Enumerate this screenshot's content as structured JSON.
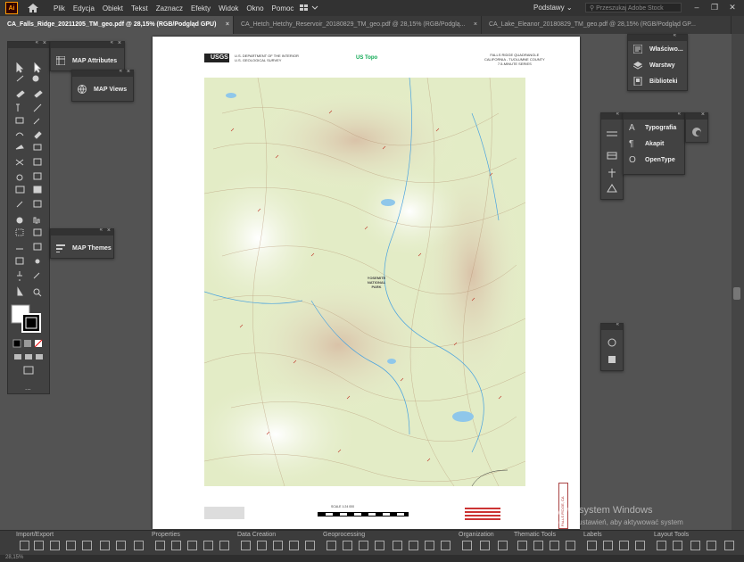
{
  "app": {
    "logo": "Ai",
    "colors": {
      "accent": "#ff9a00",
      "bg": "#535353",
      "panel": "#424242"
    }
  },
  "menu": {
    "items": [
      "Plik",
      "Edycja",
      "Obiekt",
      "Tekst",
      "Zaznacz",
      "Efekty",
      "Widok",
      "Okno",
      "Pomoc"
    ],
    "workspace": "Podstawy",
    "search_placeholder": "Przeszukaj Adobe Stock"
  },
  "tabs": [
    {
      "label": "CA_Falls_Ridge_20211205_TM_geo.pdf @ 28,15% (RGB/Podgląd GPU)",
      "close": "×",
      "active": true
    },
    {
      "label": "CA_Hetch_Hetchy_Reservoir_20180829_TM_geo.pdf @ 28,15% (RGB/Podglą...",
      "close": "×",
      "active": false
    },
    {
      "label": "CA_Lake_Eleanor_20180829_TM_geo.pdf @ 28,15% (RGB/Podgląd GP...",
      "close": "",
      "active": false
    }
  ],
  "panels": {
    "map_attributes": "MAP Attributes",
    "map_views": "MAP Views",
    "map_themes": "MAP Themes",
    "properties_group": [
      "Właściwo...",
      "Warstwy",
      "Biblioteki"
    ],
    "type_group": [
      "Typografia",
      "Akapit",
      "OpenType"
    ]
  },
  "map_sheet": {
    "agency_line1": "U.S. DEPARTMENT OF THE INTERIOR",
    "agency_line2": "U.S. GEOLOGICAL SURVEY",
    "logo": "USGS",
    "ustopo": "US Topo",
    "quad_name": "FALLS RIDGE QUADRANGLE",
    "quad_state": "CALIFORNIA - TUOLUMNE COUNTY",
    "quad_series": "7.5-MINUTE SERIES",
    "park_label": "YOSEMITE NATIONAL PARK",
    "scale_label": "SCALE 1:24 000",
    "side_id": "FALLS RIDGE, CA"
  },
  "bottom_groups": [
    "Import/Export",
    "Properties",
    "Data Creation",
    "Geoprocessing",
    "Organization",
    "Thematic Tools",
    "Labels",
    "Layout Tools"
  ],
  "watermark": {
    "line1": "Aktywuj system Windows",
    "line2": "Przejdź do ustawień, aby aktywować system"
  },
  "status": {
    "zoom": "28,15%"
  }
}
